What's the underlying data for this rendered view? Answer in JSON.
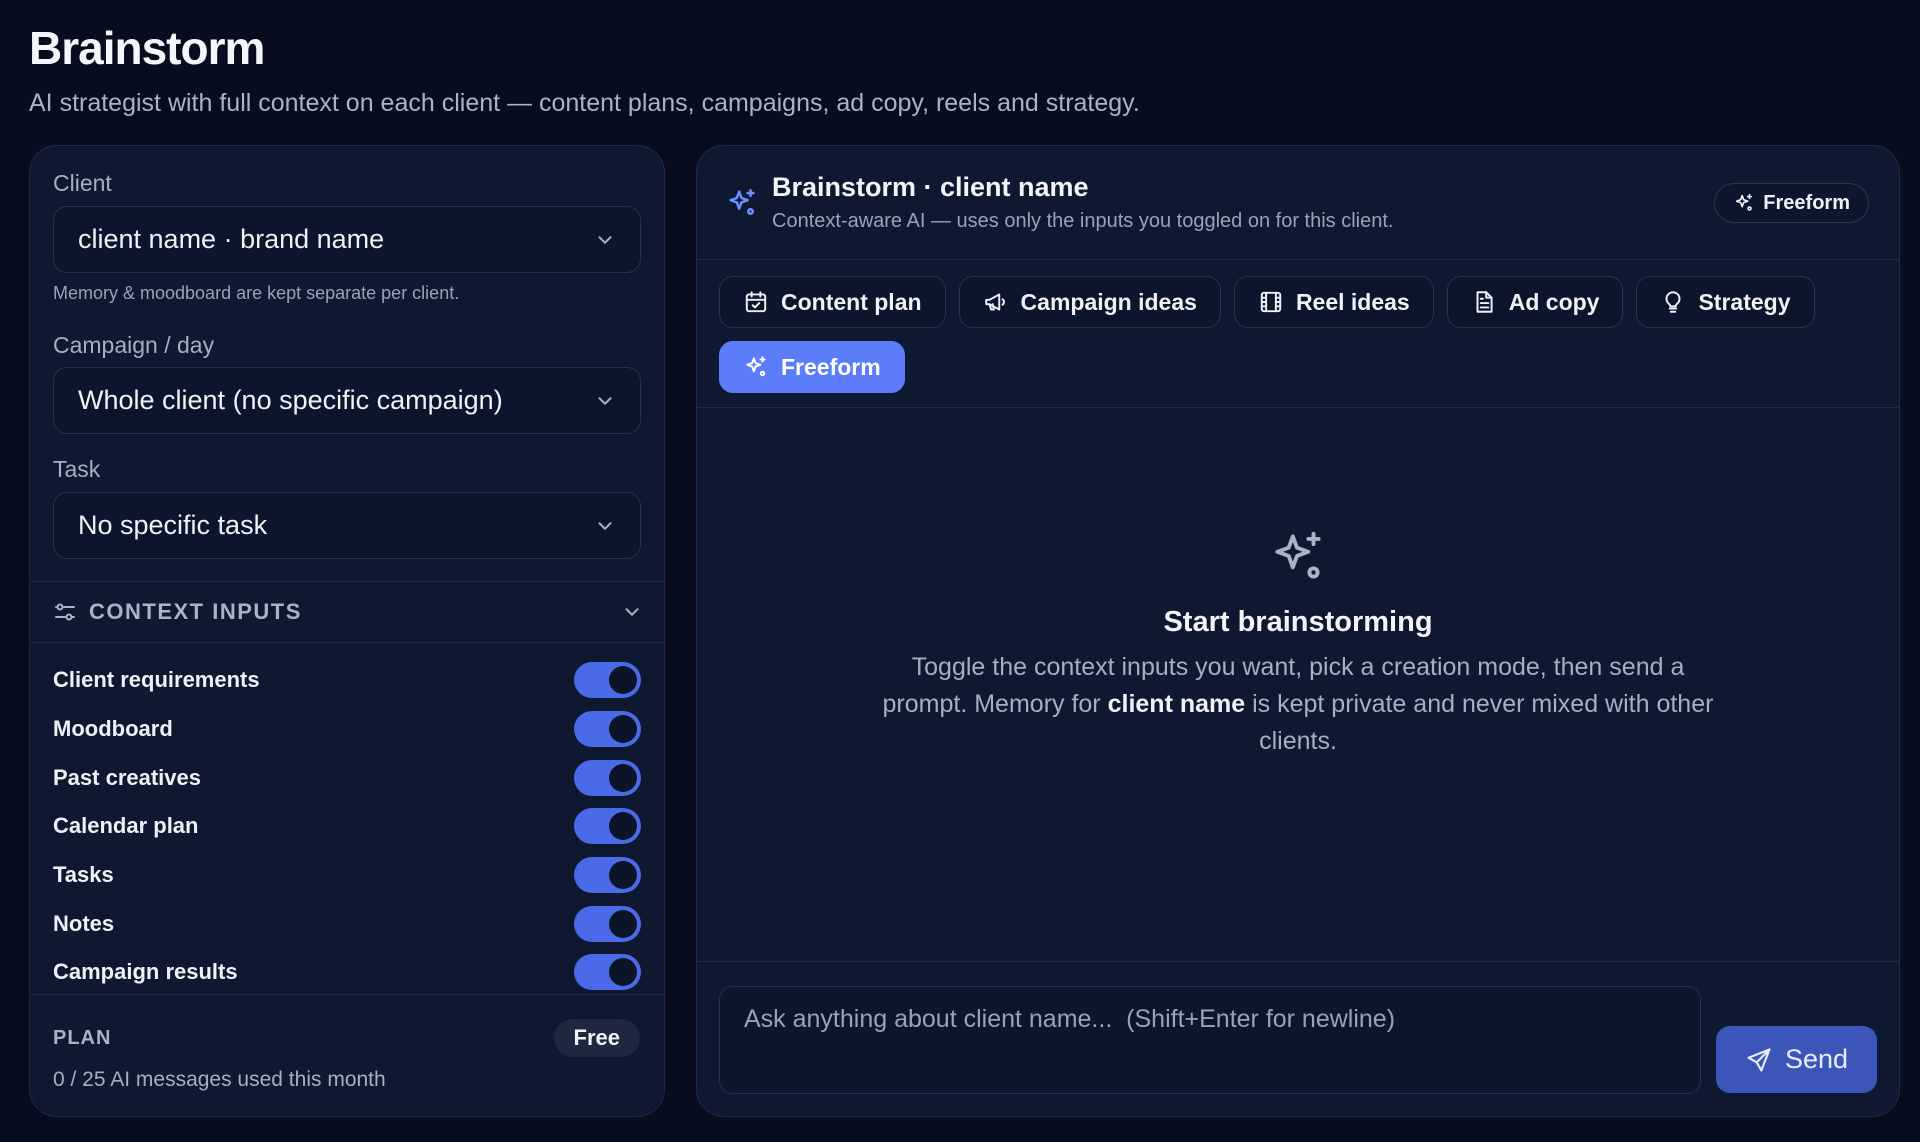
{
  "header": {
    "title": "Brainstorm",
    "subtitle": "AI strategist with full context on each client — content plans, campaigns, ad copy, reels and strategy."
  },
  "sidebar": {
    "client": {
      "label": "Client",
      "value": "client name · brand name",
      "hint": "Memory & moodboard are kept separate per client."
    },
    "campaign": {
      "label": "Campaign / day",
      "value": "Whole client (no specific campaign)"
    },
    "task": {
      "label": "Task",
      "value": "No specific task"
    },
    "context": {
      "title": "CONTEXT INPUTS",
      "items": [
        {
          "label": "Client requirements",
          "on": true
        },
        {
          "label": "Moodboard",
          "on": true
        },
        {
          "label": "Past creatives",
          "on": true
        },
        {
          "label": "Calendar plan",
          "on": true
        },
        {
          "label": "Tasks",
          "on": true
        },
        {
          "label": "Notes",
          "on": true
        },
        {
          "label": "Campaign results",
          "on": true
        }
      ]
    },
    "plan": {
      "label": "PLAN",
      "badge": "Free",
      "usage": "0 / 25 AI messages used this month"
    }
  },
  "main": {
    "title": "Brainstorm · client name",
    "subtitle": "Context-aware AI — uses only the inputs you toggled on for this client.",
    "mode_badge": "Freeform",
    "tabs": [
      {
        "label": "Content plan",
        "icon": "calendar-check-icon"
      },
      {
        "label": "Campaign ideas",
        "icon": "megaphone-icon"
      },
      {
        "label": "Reel ideas",
        "icon": "film-icon"
      },
      {
        "label": "Ad copy",
        "icon": "document-icon"
      },
      {
        "label": "Strategy",
        "icon": "lightbulb-icon"
      },
      {
        "label": "Freeform",
        "icon": "sparkles-icon",
        "active": true
      }
    ],
    "empty": {
      "title": "Start brainstorming",
      "body_before": "Toggle the context inputs you want, pick a creation mode, then send a prompt. Memory for ",
      "body_strong": "client name",
      "body_after": " is kept private and never mixed with other clients."
    },
    "composer": {
      "placeholder": "Ask anything about client name...  (Shift+Enter for newline)",
      "send_label": "Send"
    }
  },
  "colors": {
    "accent": "#5c7cfa",
    "background": "#070d1e",
    "panel": "#0e1830",
    "toggle_on": "#4b6ae8"
  }
}
